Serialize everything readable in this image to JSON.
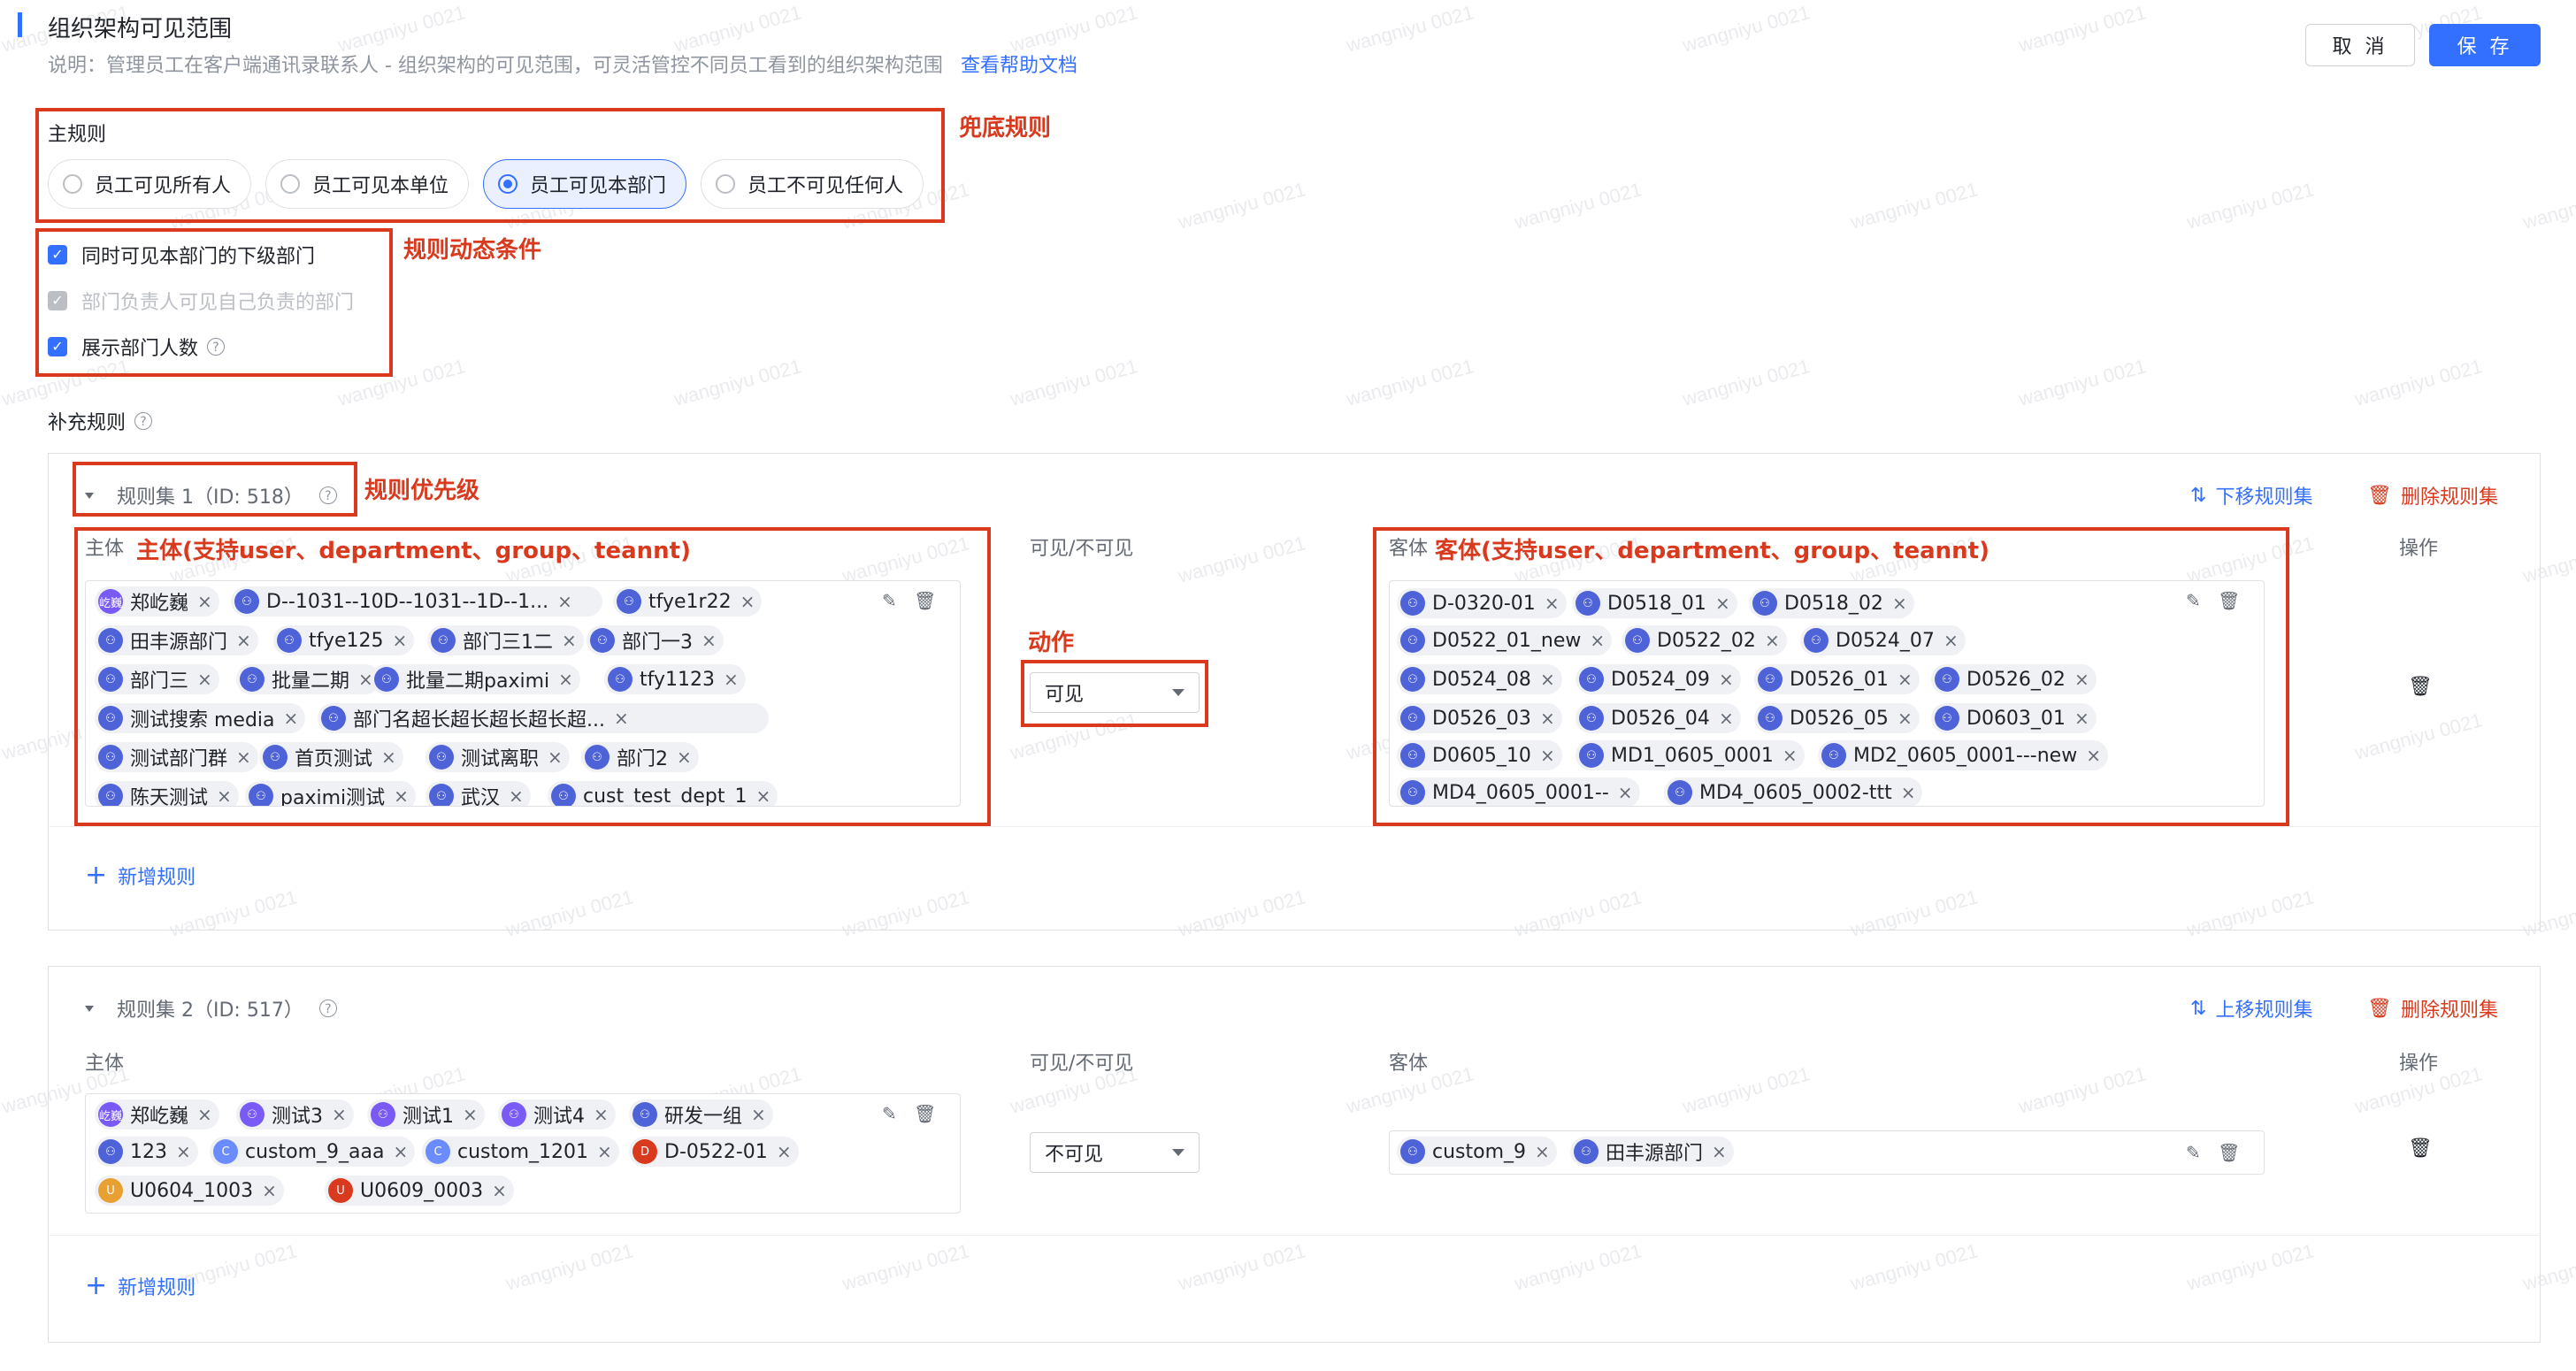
{
  "header": {
    "title": "组织架构可见范围",
    "description": "说明：管理员工在客户端通讯录联系人 - 组织架构的可见范围，可灵活管控不同员工看到的组织架构范围",
    "help_link": "查看帮助文档",
    "cancel_label": "取 消",
    "save_label": "保 存"
  },
  "annotations": {
    "fallback_rule": "兜底规则",
    "dynamic_condition": "规则动态条件",
    "rule_priority": "规则优先级",
    "subject_support": "主体(支持user、department、group、teannt)",
    "action": "动作",
    "object_support": "客体(支持user、department、group、teannt)"
  },
  "main_rule": {
    "label": "主规则",
    "options": [
      "员工可见所有人",
      "员工可见本单位",
      "员工可见本部门",
      "员工不可见任何人"
    ],
    "selected": "员工可见本部门"
  },
  "conditions": [
    {
      "label": "同时可见本部门的下级部门",
      "checked": true,
      "disabled": false
    },
    {
      "label": "部门负责人可见自己负责的部门",
      "checked": true,
      "disabled": true
    },
    {
      "label": "展示部门人数",
      "checked": true,
      "disabled": false
    }
  ],
  "supplement": {
    "label": "补充规则",
    "col_subject": "主体",
    "col_visible": "可见/不可见",
    "col_object": "客体",
    "col_ops": "操作",
    "add_rule": "新增规则"
  },
  "rule_set_1": {
    "title": "规则集 1（ID: 518）",
    "move_label": "下移规则集",
    "delete_label": "删除规则集",
    "subject_tags": [
      {
        "text": "郑屹巍",
        "icon": "user",
        "icon_text": "屹巍"
      },
      {
        "text": "D--1031--10D--1031--1D--1...",
        "icon": "dept"
      },
      {
        "text": "tfye1r22",
        "icon": "dept"
      },
      {
        "text": "田丰源部门",
        "icon": "dept"
      },
      {
        "text": "tfye125",
        "icon": "dept"
      },
      {
        "text": "部门三1二",
        "icon": "dept"
      },
      {
        "text": "部门一3",
        "icon": "dept"
      },
      {
        "text": "部门三",
        "icon": "dept"
      },
      {
        "text": "批量二期",
        "icon": "dept"
      },
      {
        "text": "批量二期paximi",
        "icon": "dept"
      },
      {
        "text": "tfy1123",
        "icon": "dept"
      },
      {
        "text": "测试搜索 media",
        "icon": "dept"
      },
      {
        "text": "部门名超长超长超长超长超...",
        "icon": "dept"
      },
      {
        "text": "测试部门群",
        "icon": "dept"
      },
      {
        "text": "首页测试",
        "icon": "dept"
      },
      {
        "text": "测试离职",
        "icon": "dept"
      },
      {
        "text": "部门2",
        "icon": "dept"
      },
      {
        "text": "陈天测试",
        "icon": "dept"
      },
      {
        "text": "paximi测试",
        "icon": "dept"
      },
      {
        "text": "武汉",
        "icon": "dept"
      },
      {
        "text": "cust_test_dept_1",
        "icon": "dept"
      }
    ],
    "action_value": "可见",
    "object_tags": [
      {
        "text": "D-0320-01",
        "icon": "dept"
      },
      {
        "text": "D0518_01",
        "icon": "dept"
      },
      {
        "text": "D0518_02",
        "icon": "dept"
      },
      {
        "text": "D0522_01_new",
        "icon": "dept"
      },
      {
        "text": "D0522_02",
        "icon": "dept"
      },
      {
        "text": "D0524_07",
        "icon": "dept"
      },
      {
        "text": "D0524_08",
        "icon": "dept"
      },
      {
        "text": "D0524_09",
        "icon": "dept"
      },
      {
        "text": "D0526_01",
        "icon": "dept"
      },
      {
        "text": "D0526_02",
        "icon": "dept"
      },
      {
        "text": "D0526_03",
        "icon": "dept"
      },
      {
        "text": "D0526_04",
        "icon": "dept"
      },
      {
        "text": "D0526_05",
        "icon": "dept"
      },
      {
        "text": "D0603_01",
        "icon": "dept"
      },
      {
        "text": "D0605_10",
        "icon": "dept"
      },
      {
        "text": "MD1_0605_0001",
        "icon": "dept"
      },
      {
        "text": "MD2_0605_0001---new",
        "icon": "dept"
      },
      {
        "text": "MD4_0605_0001--",
        "icon": "dept"
      },
      {
        "text": "MD4_0605_0002-ttt",
        "icon": "dept"
      }
    ]
  },
  "rule_set_2": {
    "title": "规则集 2（ID: 517）",
    "move_label": "上移规则集",
    "delete_label": "删除规则集",
    "subject_tags": [
      {
        "text": "郑屹巍",
        "icon": "user",
        "icon_text": "屹巍"
      },
      {
        "text": "测试3",
        "icon": "grp"
      },
      {
        "text": "测试1",
        "icon": "grp"
      },
      {
        "text": "测试4",
        "icon": "grp"
      },
      {
        "text": "研发一组",
        "icon": "dept"
      },
      {
        "text": "123",
        "icon": "dept"
      },
      {
        "text": "custom_9_aaa",
        "icon": "cust",
        "icon_text": "C"
      },
      {
        "text": "custom_1201",
        "icon": "cust",
        "icon_text": "C"
      },
      {
        "text": "D-0522-01",
        "icon": "red",
        "icon_text": "D"
      },
      {
        "text": "U0604_1003",
        "icon": "orange",
        "icon_text": "U"
      },
      {
        "text": "U0609_0003",
        "icon": "red",
        "icon_text": "U"
      }
    ],
    "action_value": "不可见",
    "object_tags": [
      {
        "text": "custom_9",
        "icon": "dept"
      },
      {
        "text": "田丰源部门",
        "icon": "dept"
      }
    ]
  },
  "watermark": "wangniyu 0021",
  "colors": {
    "accent": "#3370ff",
    "annotation": "#d9391d",
    "tag_bg": "#f0f1f5"
  }
}
